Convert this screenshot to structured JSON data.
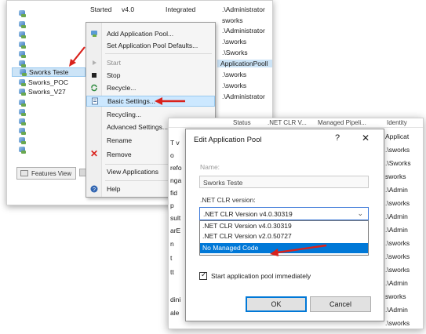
{
  "iis": {
    "tree": {
      "items": [
        {
          "label": ""
        },
        {
          "label": ""
        },
        {
          "label": ""
        },
        {
          "label": ""
        },
        {
          "label": ""
        },
        {
          "label": ""
        },
        {
          "label": "Sworks Teste"
        },
        {
          "label": "Sworks_POC"
        },
        {
          "label": "Sworks_V27"
        },
        {
          "label": ""
        },
        {
          "label": ""
        },
        {
          "label": ""
        },
        {
          "label": ""
        },
        {
          "label": ""
        },
        {
          "label": ""
        }
      ],
      "features_view": "Features View"
    },
    "top_row": {
      "status": "Started",
      "version": "v4.0",
      "pipeline": "Integrated",
      "identity": ".\\Administrator"
    },
    "right_col": [
      "sworks",
      ".\\Administrator",
      ".\\sworks",
      ".\\Sworks",
      "ApplicationPooll",
      ".\\sworks",
      ".\\sworks",
      ".\\Administrator"
    ],
    "context_menu": {
      "items": [
        {
          "label": "Add Application Pool..."
        },
        {
          "label": "Set Application Pool Defaults..."
        },
        {
          "label": "Start"
        },
        {
          "label": "Stop"
        },
        {
          "label": "Recycle..."
        },
        {
          "label": "Basic Settings..."
        },
        {
          "label": "Recycling..."
        },
        {
          "label": "Advanced Settings..."
        },
        {
          "label": "Rename"
        },
        {
          "label": "Remove"
        },
        {
          "label": "View Applications"
        },
        {
          "label": "Help"
        }
      ]
    }
  },
  "front_list": {
    "headers": {
      "status": "Status",
      "clr": ".NET CLR V...",
      "pipeline": "Managed Pipeli...",
      "identity": "Identity"
    },
    "left_stubs": [
      "T v",
      "o",
      "refo",
      "nga",
      "fid",
      "p",
      "sult",
      "arE",
      "n",
      "t",
      "tt",
      "dini",
      "ale"
    ],
    "identities": [
      "Applicat",
      ".\\sworks",
      ".\\Sworks",
      "sworks",
      ".\\Admin",
      ".\\sworks",
      ".\\Admin",
      ".\\Admin",
      ".\\sworks",
      ".\\sworks",
      ".\\sworks",
      ".\\Admin",
      "sworks",
      ".\\Admin",
      ".\\sworks"
    ]
  },
  "dialog": {
    "title": "Edit Application Pool",
    "help": "?",
    "close": "✕",
    "name_label": "Name:",
    "name_value": "Sworks Teste",
    "clr_label": ".NET CLR version:",
    "clr_selected": ".NET CLR Version v4.0.30319",
    "clr_options": [
      ".NET CLR Version v4.0.30319",
      ".NET CLR Version v2.0.50727",
      "No Managed Code"
    ],
    "start_immediately": "Start application pool immediately",
    "ok": "OK",
    "cancel": "Cancel"
  },
  "colors": {
    "highlight": "#0078d7",
    "arrow": "#d9221c",
    "selection": "#cce4f7"
  }
}
